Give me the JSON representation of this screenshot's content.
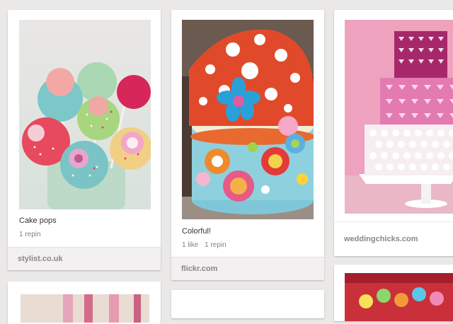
{
  "pins": [
    {
      "id": "cake-pops",
      "image_alt": "Cake pops",
      "description": "Cake pops",
      "stats": [
        "1 repin"
      ],
      "source": "stylist.co.uk"
    },
    {
      "id": "colorful",
      "image_alt": "Colorful cake",
      "description": "Colorful!",
      "stats": [
        "1 like",
        "1 repin"
      ],
      "source": "flickr.com"
    },
    {
      "id": "wedding",
      "image_alt": "Pink tiered wedding cake",
      "description": "",
      "stats": [],
      "source": "weddingchicks.com"
    }
  ]
}
